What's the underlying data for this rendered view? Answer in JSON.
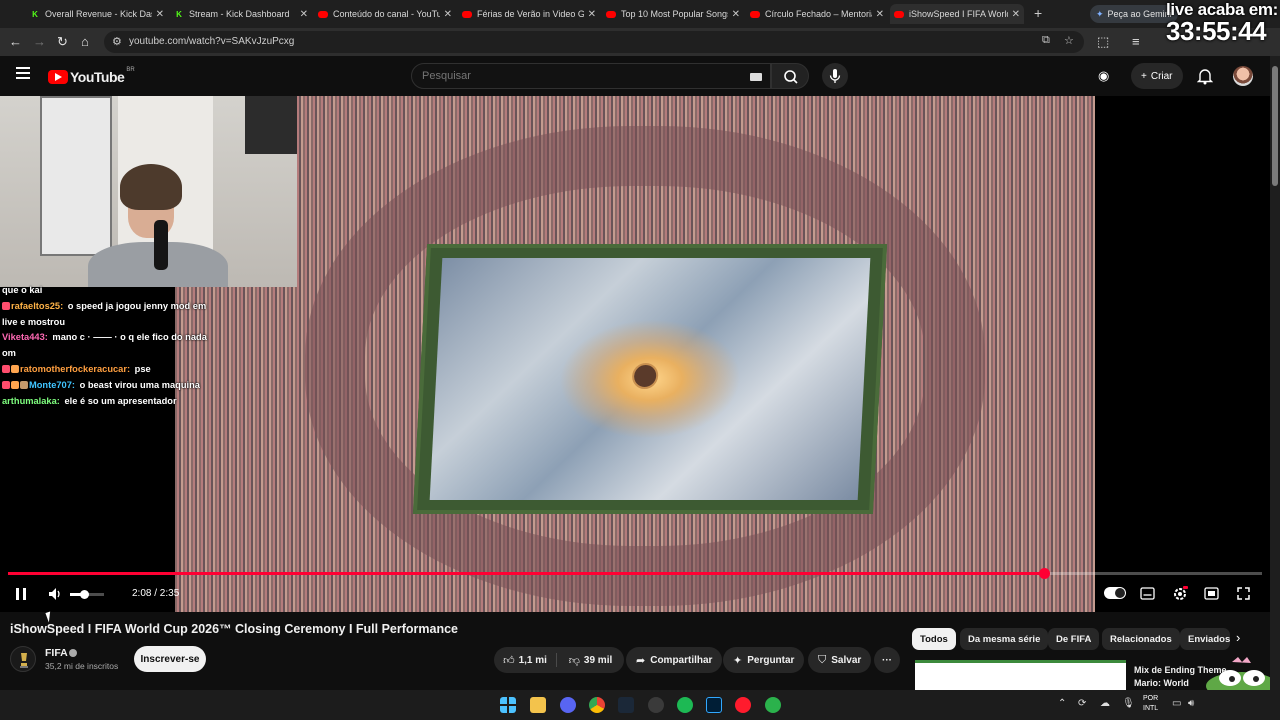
{
  "browser": {
    "tabs": [
      {
        "label": "Overall Revenue - Kick Dash",
        "favicon": "kick-icon"
      },
      {
        "label": "Stream - Kick Dashboard",
        "favicon": "kick-icon"
      },
      {
        "label": "Conteúdo do canal - YouTu",
        "favicon": "youtube-icon"
      },
      {
        "label": "Férias de Verão in Video Ga",
        "favicon": "youtube-icon"
      },
      {
        "label": "Top 10 Most Popular Songs",
        "favicon": "youtube-icon"
      },
      {
        "label": "Círculo Fechado – Mentoria",
        "favicon": "youtube-icon"
      },
      {
        "label": "iShowSpeed I FIFA World",
        "favicon": "youtube-icon"
      }
    ],
    "new_tab": "+",
    "gemini_label": "Peça ao Gemini",
    "url": "youtube.com/watch?v=SAKvJzuPcxg"
  },
  "overlay": {
    "timer_title": "live acaba em:",
    "timer_value": "33:55:44"
  },
  "youtube": {
    "logo_text": "YouTube",
    "country_code": "BR",
    "search_placeholder": "Pesquisar",
    "create_label": "Criar"
  },
  "chat": [
    {
      "user": "",
      "message": "que o kai",
      "user_color": "#ffffff",
      "badges": []
    },
    {
      "user": "rafaeltos25:",
      "message": " o speed ja jogou jenny mod em live e mostrou",
      "user_color": "#ffb347",
      "badges": [
        "#ff4d6d"
      ]
    },
    {
      "user": "Viketa443:",
      "message": " mano c · ―― · o q ele fico do nada om",
      "user_color": "#ff69b4",
      "badges": []
    },
    {
      "user": "ratomotherfockeracucar:",
      "message": " pse",
      "user_color": "#ff9f40",
      "badges": [
        "#ff4d6d",
        "#ffa54f"
      ]
    },
    {
      "user": "Monte707:",
      "message": " o beast virou uma maquina",
      "user_color": "#40c4ff",
      "badges": [
        "#ff4d6d",
        "#ffa54f",
        "#c49a6c"
      ]
    },
    {
      "user": "arthumalaka:",
      "message": " ele é so um apresentador",
      "user_color": "#7fff7f",
      "badges": []
    }
  ],
  "player": {
    "time_display": "2:08 / 2:35",
    "progress": 0.826,
    "volume": 0.4
  },
  "video": {
    "title": "iShowSpeed I FIFA World Cup 2026™ Closing Ceremony I Full Performance",
    "channel": "FIFA",
    "subscribers": "35,2 mi de inscritos",
    "subscribe_label": "Inscrever-se",
    "likes": "1,1 mi",
    "dislikes": "39 mil",
    "share_label": "Compartilhar",
    "ask_label": "Perguntar",
    "save_label": "Salvar",
    "more": "···"
  },
  "chips": [
    "Todos",
    "Da mesma série",
    "De FIFA",
    "Relacionados",
    "Enviados"
  ],
  "recommendation": {
    "title": "Mix de Ending Theme Mario: World"
  },
  "taskbar": {
    "lang_line1": "POR",
    "lang_line2": "INTL"
  },
  "colors": {
    "accent_red": "#ff0033",
    "youtube_red": "#ff0000",
    "kick_green": "#53fc18"
  }
}
